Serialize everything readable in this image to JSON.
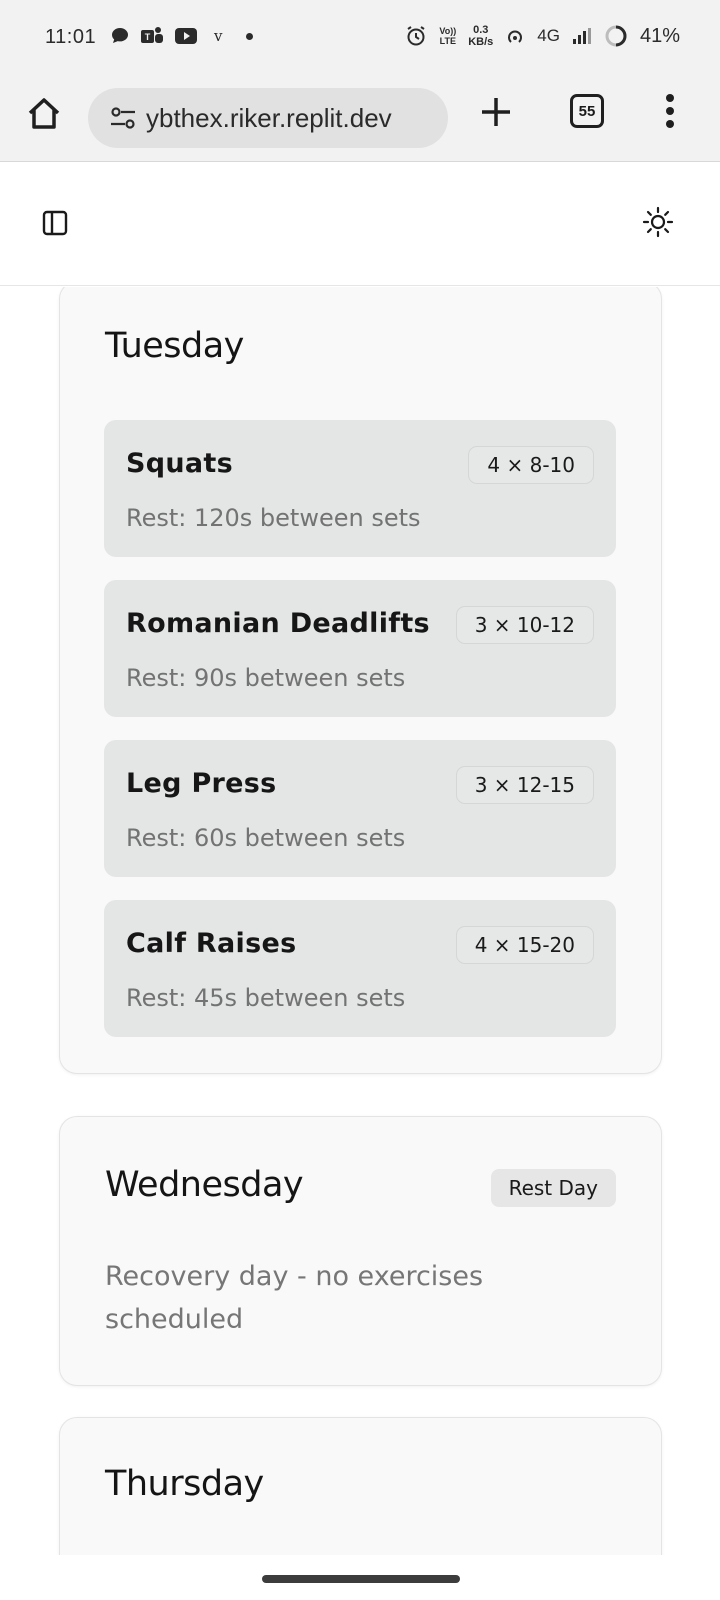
{
  "status_bar": {
    "time": "11:01",
    "left_icons": [
      "chat-icon",
      "teams-icon",
      "youtube-icon",
      "v-icon",
      "dot-icon"
    ],
    "app_letter": "v",
    "volte_top": "Vo))",
    "volte_bottom": "LTE",
    "speed_value": "0.3",
    "speed_unit": "KB/s",
    "network": "4G",
    "battery": "41%"
  },
  "browser": {
    "url": "ybthex.riker.replit.dev",
    "tab_count": "55"
  },
  "schedule": {
    "days": [
      {
        "name": "Tuesday",
        "exercises": [
          {
            "name": "Squats",
            "sets": "4 × 8-10",
            "rest": "Rest: 120s between sets"
          },
          {
            "name": "Romanian Deadlifts",
            "sets": "3 × 10-12",
            "rest": "Rest: 90s between sets"
          },
          {
            "name": "Leg Press",
            "sets": "3 × 12-15",
            "rest": "Rest: 60s between sets"
          },
          {
            "name": "Calf Raises",
            "sets": "4 × 15-20",
            "rest": "Rest: 45s between sets"
          }
        ]
      },
      {
        "name": "Wednesday",
        "badge": "Rest Day",
        "description": "Recovery day - no exercises scheduled"
      },
      {
        "name": "Thursday"
      }
    ]
  },
  "colors": {
    "card_bg": "#f9f9f9",
    "exercise_bg": "#e4e5e5",
    "muted_text": "#737373"
  }
}
